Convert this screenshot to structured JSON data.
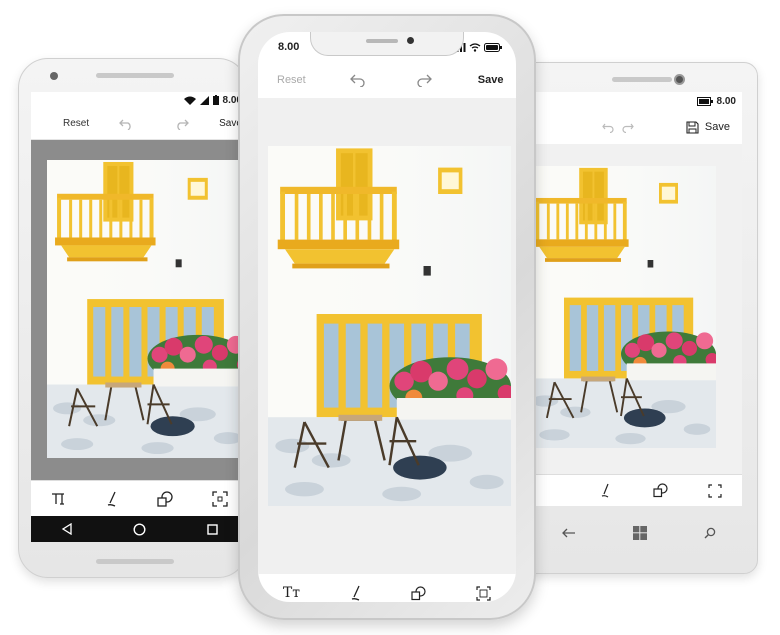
{
  "android": {
    "status_time": "8.00",
    "reset_label": "Reset",
    "save_label": "Save"
  },
  "iphone": {
    "status_time": "8.00",
    "reset_label": "Reset",
    "save_label": "Save",
    "tool_text_label": "Tт"
  },
  "windows": {
    "status_time": "8.00",
    "save_label": "Save"
  },
  "icons": [
    "wifi-icon",
    "signal-icon",
    "battery-icon",
    "undo-icon",
    "redo-icon",
    "text-tool-icon",
    "pen-tool-icon",
    "shape-tool-icon",
    "crop-tool-icon",
    "back-icon",
    "home-icon",
    "recents-icon",
    "windows-icon",
    "search-icon",
    "save-icon"
  ],
  "colors": {
    "door_yellow": "#f2c230",
    "wall": "#fbfbf8",
    "flowers": "#e0457a",
    "android_canvas_bg": "#8c8c8c",
    "nav_bar": "#111111"
  }
}
